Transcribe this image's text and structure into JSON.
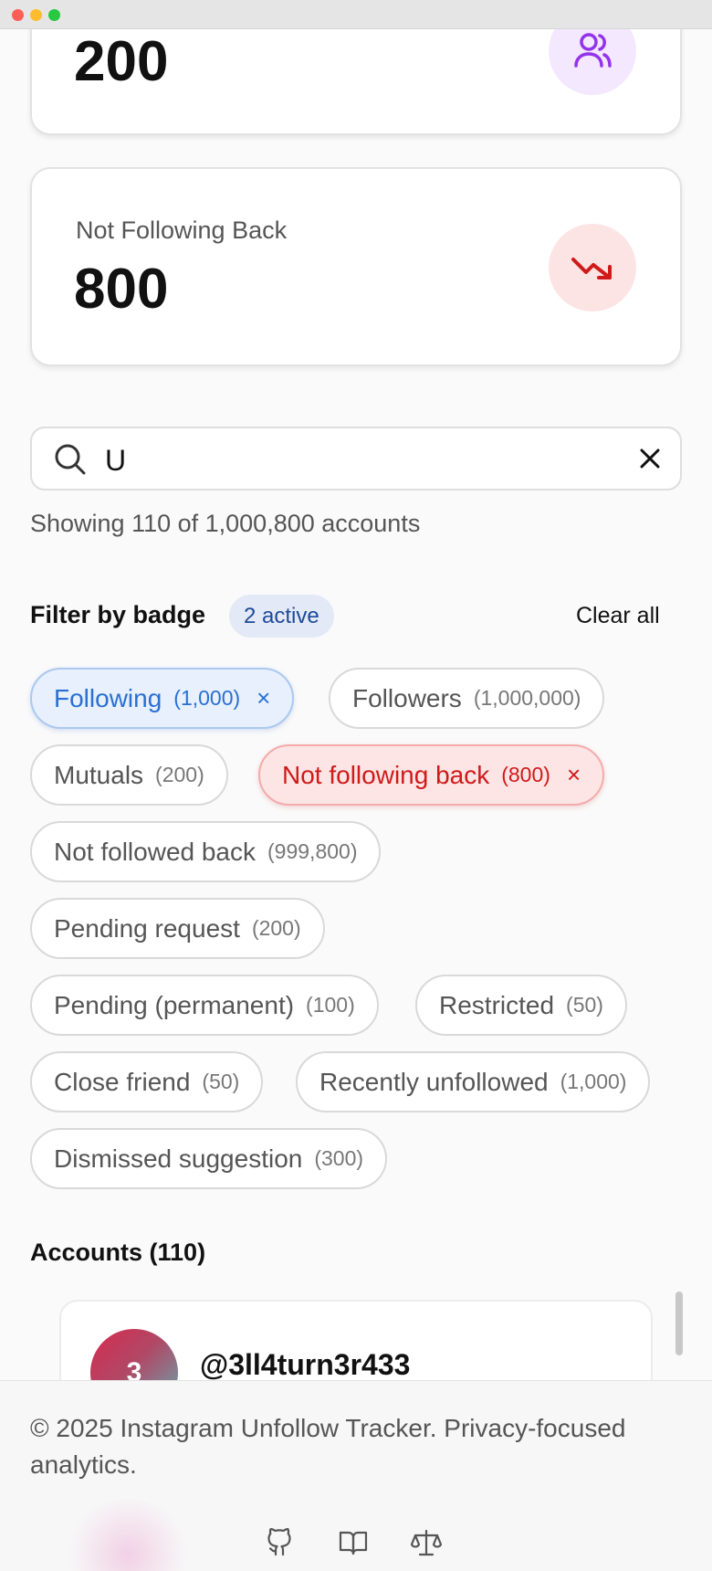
{
  "stats": {
    "mutuals_value": "200",
    "not_following_back_label": "Not Following Back",
    "not_following_back_value": "800"
  },
  "search": {
    "value": "U",
    "showing_text": "Showing 110 of 1,000,800 accounts"
  },
  "filter": {
    "title": "Filter by badge",
    "active_badge": "2 active",
    "clear_all": "Clear all",
    "chips": [
      {
        "label": "Following",
        "count": "(1,000)",
        "state": "active-blue"
      },
      {
        "label": "Followers",
        "count": "(1,000,000)",
        "state": "inactive"
      },
      {
        "label": "Mutuals",
        "count": "(200)",
        "state": "inactive"
      },
      {
        "label": "Not following back",
        "count": "(800)",
        "state": "active-red"
      },
      {
        "label": "Not followed back",
        "count": "(999,800)",
        "state": "inactive"
      },
      {
        "label": "Pending request",
        "count": "(200)",
        "state": "inactive"
      },
      {
        "label": "Pending (permanent)",
        "count": "(100)",
        "state": "inactive"
      },
      {
        "label": "Restricted",
        "count": "(50)",
        "state": "inactive"
      },
      {
        "label": "Close friend",
        "count": "(50)",
        "state": "inactive"
      },
      {
        "label": "Recently unfollowed",
        "count": "(1,000)",
        "state": "inactive"
      },
      {
        "label": "Dismissed suggestion",
        "count": "(300)",
        "state": "inactive"
      }
    ],
    "remove_glyph": "×"
  },
  "accounts": {
    "title": "Accounts (110)",
    "items": [
      {
        "avatar_initial": "3",
        "username": "@3ll4turn3r433"
      }
    ]
  },
  "footer": {
    "text": "© 2025 Instagram Unfollow Tracker. Privacy-focused analytics.",
    "icons": [
      "github-icon",
      "book-icon",
      "scale-icon"
    ]
  },
  "colors": {
    "accent_blue": "#2a6fd2",
    "accent_red": "#d01a1a",
    "purple": "#9333ea"
  }
}
